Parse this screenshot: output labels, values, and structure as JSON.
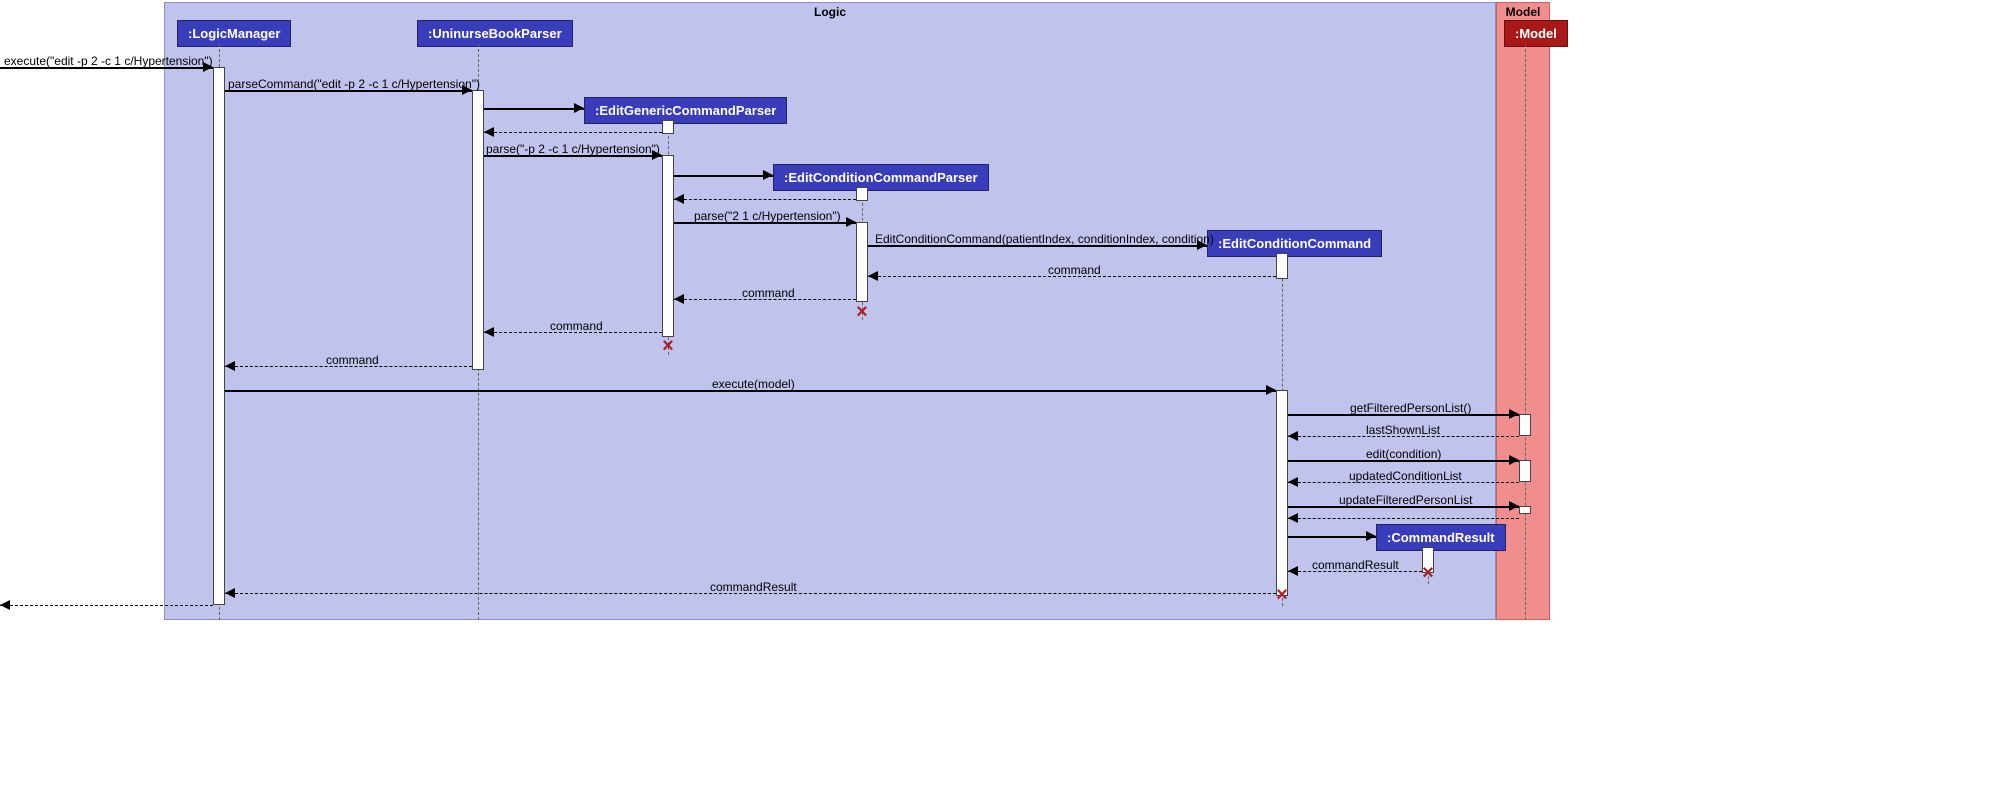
{
  "frames": {
    "logic": "Logic",
    "model": "Model"
  },
  "participants": {
    "logicManager": ":LogicManager",
    "uninurseBookParser": ":UninurseBookParser",
    "editGenericCommandParser": ":EditGenericCommandParser",
    "editConditionCommandParser": ":EditConditionCommandParser",
    "editConditionCommand": ":EditConditionCommand",
    "commandResult": ":CommandResult",
    "model": ":Model"
  },
  "messages": {
    "m1": "execute(\"edit -p 2 -c 1 c/Hypertension\")",
    "m2": "parseCommand(\"edit -p 2 -c 1 c/Hypertension\")",
    "m3": "parse(\"-p 2 -c 1 c/Hypertension\")",
    "m4": "parse(\"2 1 c/Hypertension\")",
    "m5": "EditConditionCommand(patientIndex, conditionIndex, condition)",
    "m6": "command",
    "m7": "command",
    "m8": "command",
    "m9": "command",
    "m10": "execute(model)",
    "m11": "getFilteredPersonList()",
    "m12": "lastShownList",
    "m13": "edit(condition)",
    "m14": "updatedConditionList",
    "m15": "updateFilteredPersonList",
    "m16": "commandResult",
    "m17": "commandResult"
  }
}
